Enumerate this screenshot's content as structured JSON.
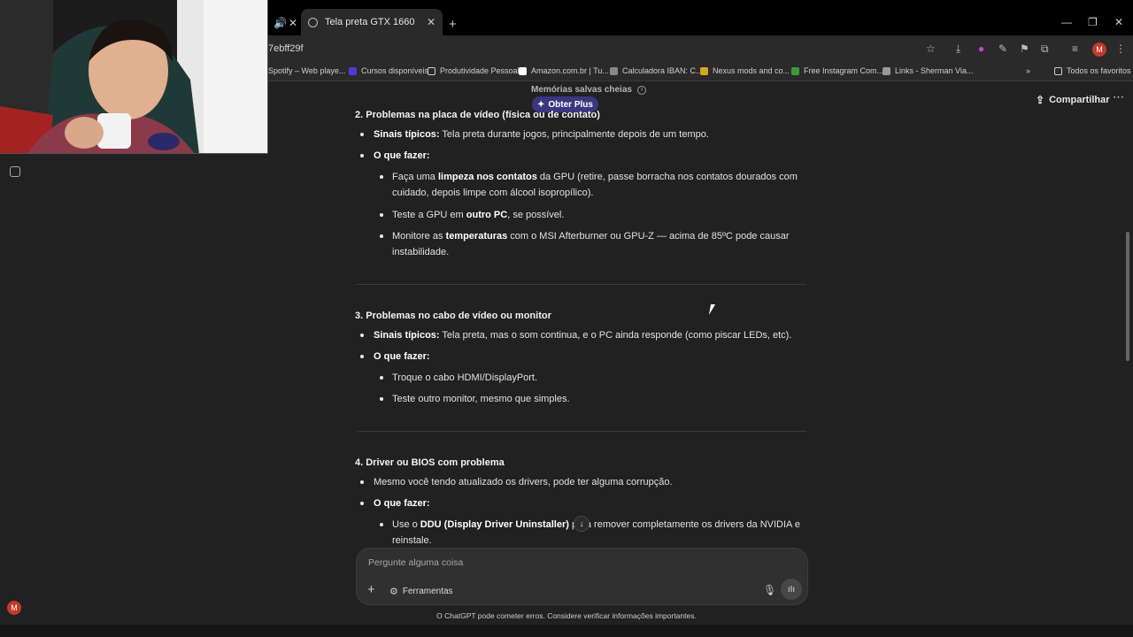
{
  "browser": {
    "active_tab_title": "Tela preta GTX 1660",
    "address_fragment": "7ebff29f",
    "profile_initial": "M",
    "bookmarks": [
      {
        "label": "Spotify – Web playe...",
        "icon": "spotify-icon"
      },
      {
        "label": "Cursos disponíveis",
        "icon": "f-logo-icon"
      },
      {
        "label": "Produtividade Pessoal",
        "icon": "book-icon"
      },
      {
        "label": "Amazon.com.br | Tu...",
        "icon": "amazon-icon"
      },
      {
        "label": "Calculadora IBAN: C...",
        "icon": "globe-icon"
      },
      {
        "label": "Nexus mods and co...",
        "icon": "nexus-icon"
      },
      {
        "label": "Free Instagram Com...",
        "icon": "w-logo-icon"
      },
      {
        "label": "Links - Sherman Via...",
        "icon": "linktree-icon"
      }
    ],
    "all_bookmarks_label": "Todos os favoritos"
  },
  "header": {
    "memory_notice": "Memórias salvas cheias",
    "get_plus_label": "Obter Plus",
    "share_label": "Compartilhar"
  },
  "content": {
    "s2_title": "2. Problemas na placa de vídeo (física ou de contato)",
    "s2_signs_label": "Sinais típicos:",
    "s2_signs_text": " Tela preta durante jogos, principalmente depois de um tempo.",
    "s2_todo_label": "O que fazer:",
    "s2_i1_a": "Faça uma ",
    "s2_i1_b": "limpeza nos contatos",
    "s2_i1_c": " da GPU (retire, passe borracha nos contatos dourados com",
    "s2_i1_d": "cuidado, depois limpe com álcool isopropílico).",
    "s2_i2_a": "Teste a GPU em ",
    "s2_i2_b": "outro PC",
    "s2_i2_c": ", se possível.",
    "s2_i3_a": "Monitore as ",
    "s2_i3_b": "temperaturas",
    "s2_i3_c": " com o MSI Afterburner ou GPU-Z — acima de 85ºC pode causar",
    "s2_i3_d": "instabilidade.",
    "s3_title": "3. Problemas no cabo de vídeo ou monitor",
    "s3_signs_label": "Sinais típicos:",
    "s3_signs_text": " Tela preta, mas o som continua, e o PC ainda responde (como piscar LEDs, etc).",
    "s3_todo_label": "O que fazer:",
    "s3_i1": "Troque o cabo HDMI/DisplayPort.",
    "s3_i2": "Teste outro monitor, mesmo que simples.",
    "s4_title": "4. Driver ou BIOS com problema",
    "s4_p1": "Mesmo você tendo atualizado os drivers, pode ter alguma corrupção.",
    "s4_todo_label": "O que fazer:",
    "s4_i1_a": "Use o ",
    "s4_i1_b": "DDU (Display Driver Uninstaller)",
    "s4_i1_c": " para remover completamente os drivers da NVIDIA e",
    "s4_i1_d": "reinstale."
  },
  "composer": {
    "placeholder": "Pergunte alguma coisa",
    "tools_label": "Ferramentas"
  },
  "footer": {
    "disclaimer": "O ChatGPT pode cometer erros. Considere verificar informações importantes."
  },
  "sidebar": {
    "user_initial": "M"
  },
  "colors": {
    "background": "#212121",
    "plus_button": "#3b3680",
    "avatar": "#c23a2b"
  }
}
